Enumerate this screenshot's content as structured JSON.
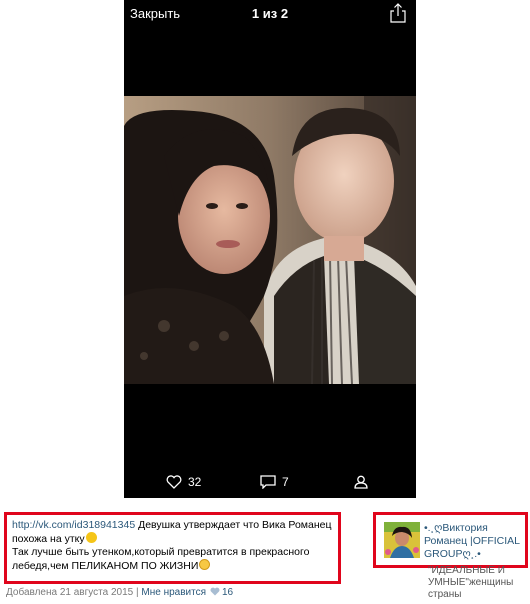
{
  "viewer": {
    "close_label": "Закрыть",
    "counter": "1 из 2",
    "likes_count": "32",
    "comments_count": "7"
  },
  "post": {
    "link_text": "http://vk.com/id318941345",
    "line1": " Девушка утверждает что Вика Романец похожа на утку",
    "line2": "Так лучше быть утенком,который превратится в прекрасного лебедя,чем ПЕЛИКАНОМ ПО ЖИЗНИ"
  },
  "meta": {
    "added": "Добавлена 21 августа 2015",
    "separator": " | ",
    "like_label": "Мне нравится",
    "like_count": "16"
  },
  "group": {
    "name": "•.¸ღВиктория Романец |OFFICIAL GROUPღ¸.•",
    "description_line1": "\"ИДЕАЛЬНЫЕ И",
    "description_line2": "УМНЫЕ\"женщины",
    "description_line3": "страны"
  },
  "colors": {
    "highlight": "#e0051c",
    "link": "#2b587a"
  }
}
